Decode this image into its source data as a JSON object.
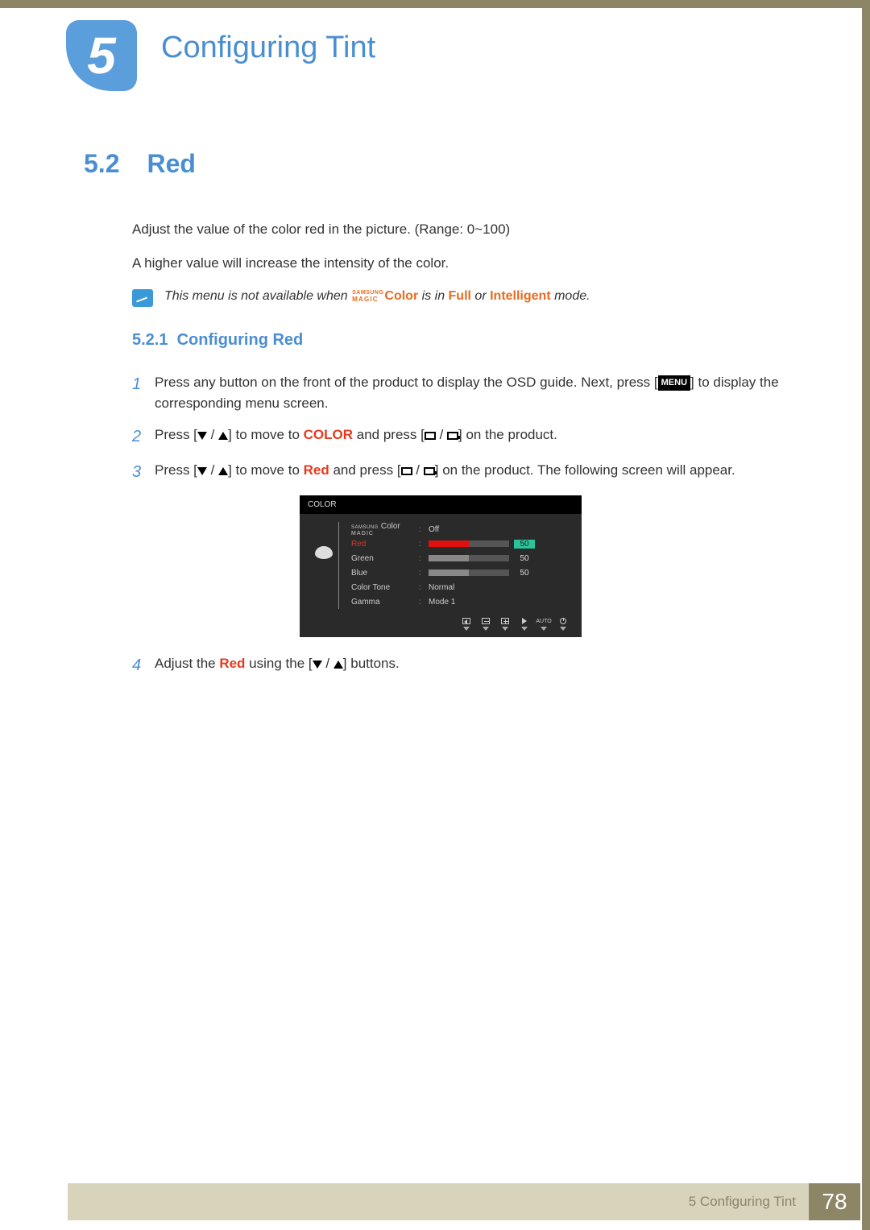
{
  "chapter": {
    "number": "5",
    "title": "Configuring Tint"
  },
  "section": {
    "number": "5.2",
    "title": "Red"
  },
  "intro": {
    "line1": "Adjust the value of the color red in the picture. (Range: 0~100)",
    "line2": "A higher value will increase the intensity of the color."
  },
  "note": {
    "prefix": "This menu is not available when ",
    "magic_top": "SAMSUNG",
    "magic_bottom": "MAGIC",
    "color_word": "Color",
    "mid": " is in ",
    "full": "Full",
    "or": " or ",
    "intelligent": "Intelligent",
    "suffix": " mode."
  },
  "subsection": {
    "number": "5.2.1",
    "title": "Configuring Red"
  },
  "steps": {
    "s1": {
      "num": "1",
      "a": "Press any button on the front of the product to display the OSD guide. Next, press [",
      "menu": "MENU",
      "b": "] to display the corresponding menu screen."
    },
    "s2": {
      "num": "2",
      "a": "Press [",
      "b": "] to move to ",
      "color": "COLOR",
      "c": " and press [",
      "d": "] on the product."
    },
    "s3": {
      "num": "3",
      "a": "Press [",
      "b": "] to move to ",
      "red": "Red",
      "c": " and press [",
      "d": "] on the product. The following screen will appear."
    },
    "s4": {
      "num": "4",
      "a": "Adjust the ",
      "red": "Red",
      "b": " using the [",
      "c": "] buttons."
    }
  },
  "osd": {
    "header": "COLOR",
    "magic_top": "SAMSUNG",
    "magic_bottom": "MAGIC",
    "magic_suffix": "Color",
    "rows": {
      "magic_val": "Off",
      "red_label": "Red",
      "red_val": "50",
      "green_label": "Green",
      "green_val": "50",
      "blue_label": "Blue",
      "blue_val": "50",
      "tone_label": "Color Tone",
      "tone_val": "Normal",
      "gamma_label": "Gamma",
      "gamma_val": "Mode 1"
    },
    "nav_auto": "AUTO"
  },
  "footer": {
    "chapter_ref": "5 Configuring Tint",
    "page": "78"
  }
}
